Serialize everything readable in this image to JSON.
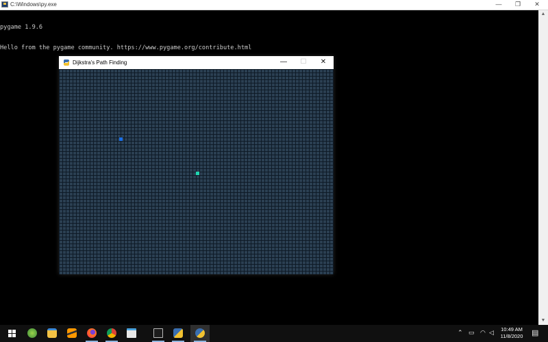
{
  "console": {
    "title": "C:\\Windows\\py.exe",
    "controls": {
      "minimize": "—",
      "restore": "❐",
      "close": "✕"
    },
    "lines": [
      "pygame 1.9.6",
      "Hello from the pygame community. https://www.pygame.org/contribute.html"
    ]
  },
  "pygame_window": {
    "title": "Dijkstra's Path Finding",
    "controls": {
      "minimize": "—",
      "maximize": "☐",
      "close": "✕"
    },
    "colors": {
      "grid_fill": "#2b3f52",
      "grid_line": "#0e1a26",
      "start_node": "#1a6fe8",
      "end_node": "#1fd6b0"
    }
  },
  "taskbar": {
    "icons": [
      "windows-start-icon",
      "pycharm-icon",
      "file-explorer-icon",
      "sublime-text-icon",
      "firefox-icon",
      "chrome-icon",
      "notepad-icon",
      "terminal-icon",
      "python-idle-icon",
      "pygame-icon"
    ],
    "clock": {
      "time": "10:49 AM",
      "date": "11/8/2020"
    }
  }
}
